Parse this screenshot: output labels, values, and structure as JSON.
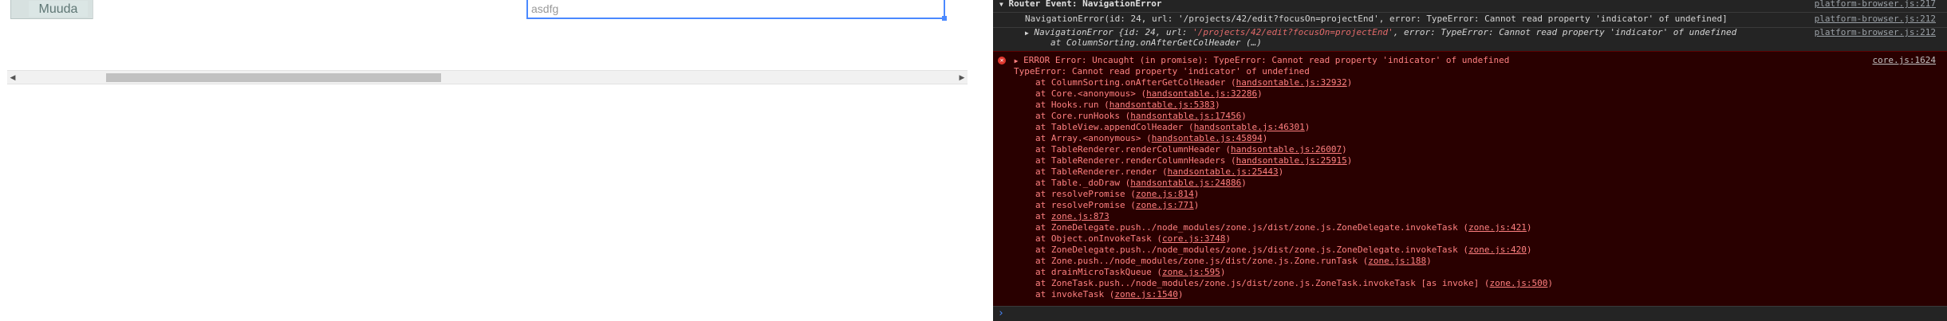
{
  "grid": {
    "button_label": "Muuda",
    "edit_value": "asdfg"
  },
  "console": {
    "group_header": "Router Event: NavigationError",
    "group_header_source": "platform-browser.js:217",
    "nav_line": "NavigationError(id: 24, url: '/projects/42/edit?focusOn=projectEnd', error: TypeError: Cannot read property 'indicator' of undefined]",
    "nav_line_source": "platform-browser.js:212",
    "obj_line_prefix": "NavigationError {id: 24, url: ",
    "obj_line_url": "'/projects/42/edit?focusOn=projectEnd'",
    "obj_line_suffix": ", error: TypeError: Cannot read property 'indicator' of undefined",
    "obj_line2": "at ColumnSorting.onAfterGetColHeader (…)",
    "obj_line_source": "platform-browser.js:212",
    "error_head": "ERROR Error: Uncaught (in promise): TypeError: Cannot read property 'indicator' of undefined",
    "error_source": "core.js:1624",
    "error_sub": "TypeError: Cannot read property 'indicator' of undefined",
    "stack": [
      {
        "prefix": "at ColumnSorting.onAfterGetColHeader (",
        "link": "handsontable.js:32932",
        "suffix": ")"
      },
      {
        "prefix": "at Core.<anonymous> (",
        "link": "handsontable.js:32286",
        "suffix": ")"
      },
      {
        "prefix": "at Hooks.run (",
        "link": "handsontable.js:5383",
        "suffix": ")"
      },
      {
        "prefix": "at Core.runHooks (",
        "link": "handsontable.js:17456",
        "suffix": ")"
      },
      {
        "prefix": "at TableView.appendColHeader (",
        "link": "handsontable.js:46301",
        "suffix": ")"
      },
      {
        "prefix": "at Array.<anonymous> (",
        "link": "handsontable.js:45894",
        "suffix": ")"
      },
      {
        "prefix": "at TableRenderer.renderColumnHeader (",
        "link": "handsontable.js:26007",
        "suffix": ")"
      },
      {
        "prefix": "at TableRenderer.renderColumnHeaders (",
        "link": "handsontable.js:25915",
        "suffix": ")"
      },
      {
        "prefix": "at TableRenderer.render (",
        "link": "handsontable.js:25443",
        "suffix": ")"
      },
      {
        "prefix": "at Table._doDraw (",
        "link": "handsontable.js:24886",
        "suffix": ")"
      },
      {
        "prefix": "at resolvePromise (",
        "link": "zone.js:814",
        "suffix": ")"
      },
      {
        "prefix": "at resolvePromise (",
        "link": "zone.js:771",
        "suffix": ")"
      },
      {
        "prefix": "at ",
        "link": "zone.js:873",
        "suffix": ""
      },
      {
        "prefix": "at ZoneDelegate.push../node_modules/zone.js/dist/zone.js.ZoneDelegate.invokeTask (",
        "link": "zone.js:421",
        "suffix": ")"
      },
      {
        "prefix": "at Object.onInvokeTask (",
        "link": "core.js:3748",
        "suffix": ")"
      },
      {
        "prefix": "at ZoneDelegate.push../node_modules/zone.js/dist/zone.js.ZoneDelegate.invokeTask (",
        "link": "zone.js:420",
        "suffix": ")"
      },
      {
        "prefix": "at Zone.push../node_modules/zone.js/dist/zone.js.Zone.runTask (",
        "link": "zone.js:188",
        "suffix": ")"
      },
      {
        "prefix": "at drainMicroTaskQueue (",
        "link": "zone.js:595",
        "suffix": ")"
      },
      {
        "prefix": "at ZoneTask.push../node_modules/zone.js/dist/zone.js.ZoneTask.invokeTask [as invoke] (",
        "link": "zone.js:500",
        "suffix": ")"
      },
      {
        "prefix": "at invokeTask (",
        "link": "zone.js:1540",
        "suffix": ")"
      }
    ],
    "prompt_symbol": "›"
  },
  "icons": {
    "collapse": "chevron-down-icon",
    "expand": "chevron-right-icon",
    "error": "error-circle-icon",
    "scroll_left": "scroll-left-icon",
    "scroll_right": "scroll-right-icon"
  },
  "colors": {
    "console_bg": "#242424",
    "error_bg": "#290000",
    "error_text": "#ff8080",
    "selection_border": "#4b89ff"
  }
}
